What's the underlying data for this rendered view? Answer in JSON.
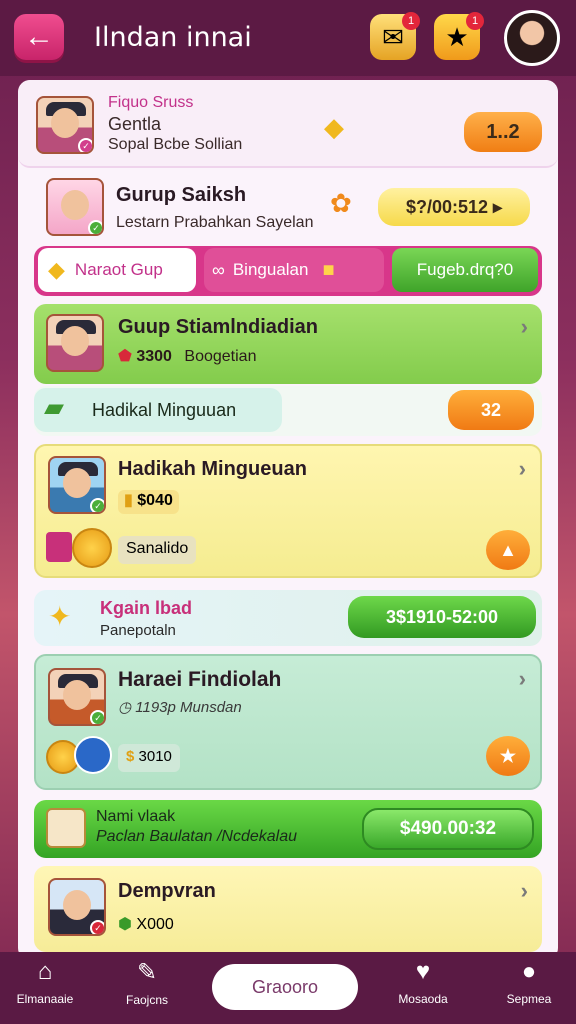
{
  "header": {
    "title": "Ilndan innai",
    "icon1": "gift-icon",
    "icon1_badge": "1",
    "icon2": "mascot-icon",
    "icon2_badge": "1"
  },
  "card1": {
    "line1": "Fiquo Sruss",
    "line2": "Gentla",
    "line3": "Sopal Bcbe Sollian",
    "pill": "1..2"
  },
  "card2": {
    "title": "Gurup Saiksh",
    "sub": "Lestarn Prabahkan Sayelan",
    "pill": "$?/00:512 ▸"
  },
  "tabs": [
    {
      "label": "Naraot Gup"
    },
    {
      "label": "Bingualan"
    },
    {
      "label": "Fugeb.drq?0"
    }
  ],
  "items": [
    {
      "title": "Guup Stiamlndiadian",
      "sub": "3300",
      "sub2": "Boogetian",
      "chevron": "›"
    },
    {
      "label": "Hadikal Minguuan",
      "pill": "32"
    },
    {
      "title": "Hadikah Mingueuan",
      "sub": "$040",
      "tag": "Sanalido",
      "chevron": "›"
    },
    {
      "title": "Kgain lbad",
      "sub": "Panepotaln",
      "pill": "3$1910-52:00"
    },
    {
      "title": "Haraei Findiolah",
      "sub": "1193p Munsdan",
      "sub2": "3010",
      "chevron": "›"
    },
    {
      "title": "Nami vlaak",
      "sub": "Paclan Baulatan /Ncdekalau",
      "pill": "$490.00:32"
    },
    {
      "title": "Dempvran",
      "sub": "X000",
      "chevron": "›"
    }
  ],
  "nav": [
    {
      "label": "Elmanaaie"
    },
    {
      "label": "Faojcns"
    },
    {
      "label": "Graooro"
    },
    {
      "label": "Mosaoda"
    },
    {
      "label": "Sepmea"
    }
  ],
  "colors": {
    "accent": "#e0358a",
    "green": "#4cb82e",
    "orange": "#f08a1c",
    "yellow": "#f7ef9a"
  }
}
